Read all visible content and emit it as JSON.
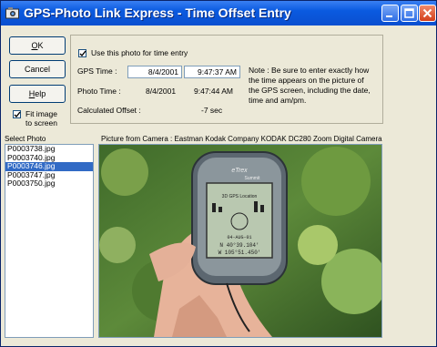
{
  "window": {
    "title": "GPS-Photo Link Express - Time Offset Entry"
  },
  "buttons": {
    "ok_hotkey": "O",
    "ok_rest": "K",
    "cancel_label": "Cancel",
    "help_hotkey": "H",
    "help_rest": "elp"
  },
  "fit": {
    "line1": "Fit image",
    "line2": "to screen",
    "checked": true
  },
  "entry": {
    "use_photo_label": "Use this photo for time entry",
    "use_photo_checked": true,
    "gps_time_label": "GPS Time :",
    "gps_date": "8/4/2001",
    "gps_time": "9:47:37 AM",
    "photo_time_label": "Photo Time :",
    "photo_date": "8/4/2001",
    "photo_time": "9:47:44 AM",
    "offset_label": "Calculated Offset :",
    "offset_value": "-7 sec"
  },
  "note": "Note : Be sure to enter exactly how the time appears on the picture of the GPS screen, including the date, time and am/pm.",
  "select_photo": {
    "header": "Select Photo",
    "files": [
      "P0003738.jpg",
      "P0003740.jpg",
      "P0003746.jpg",
      "P0003747.jpg",
      "P0003750.jpg"
    ],
    "selected_index": 2
  },
  "picture": {
    "header": "Picture from Camera : Eastman Kodak Company KODAK DC280 Zoom Digital Camera",
    "gps_brand": "eTrex",
    "gps_model": "Summit",
    "gps_screen_line1": "3D GPS Location",
    "gps_screen_line2": "04-AUG-01",
    "gps_screen_line3": "N 40°39.104'",
    "gps_screen_line4": "W 105°51.450'"
  },
  "colors": {
    "title_bar": "#0a5ae0",
    "selection": "#316ac5",
    "dialog": "#ece9d8"
  }
}
